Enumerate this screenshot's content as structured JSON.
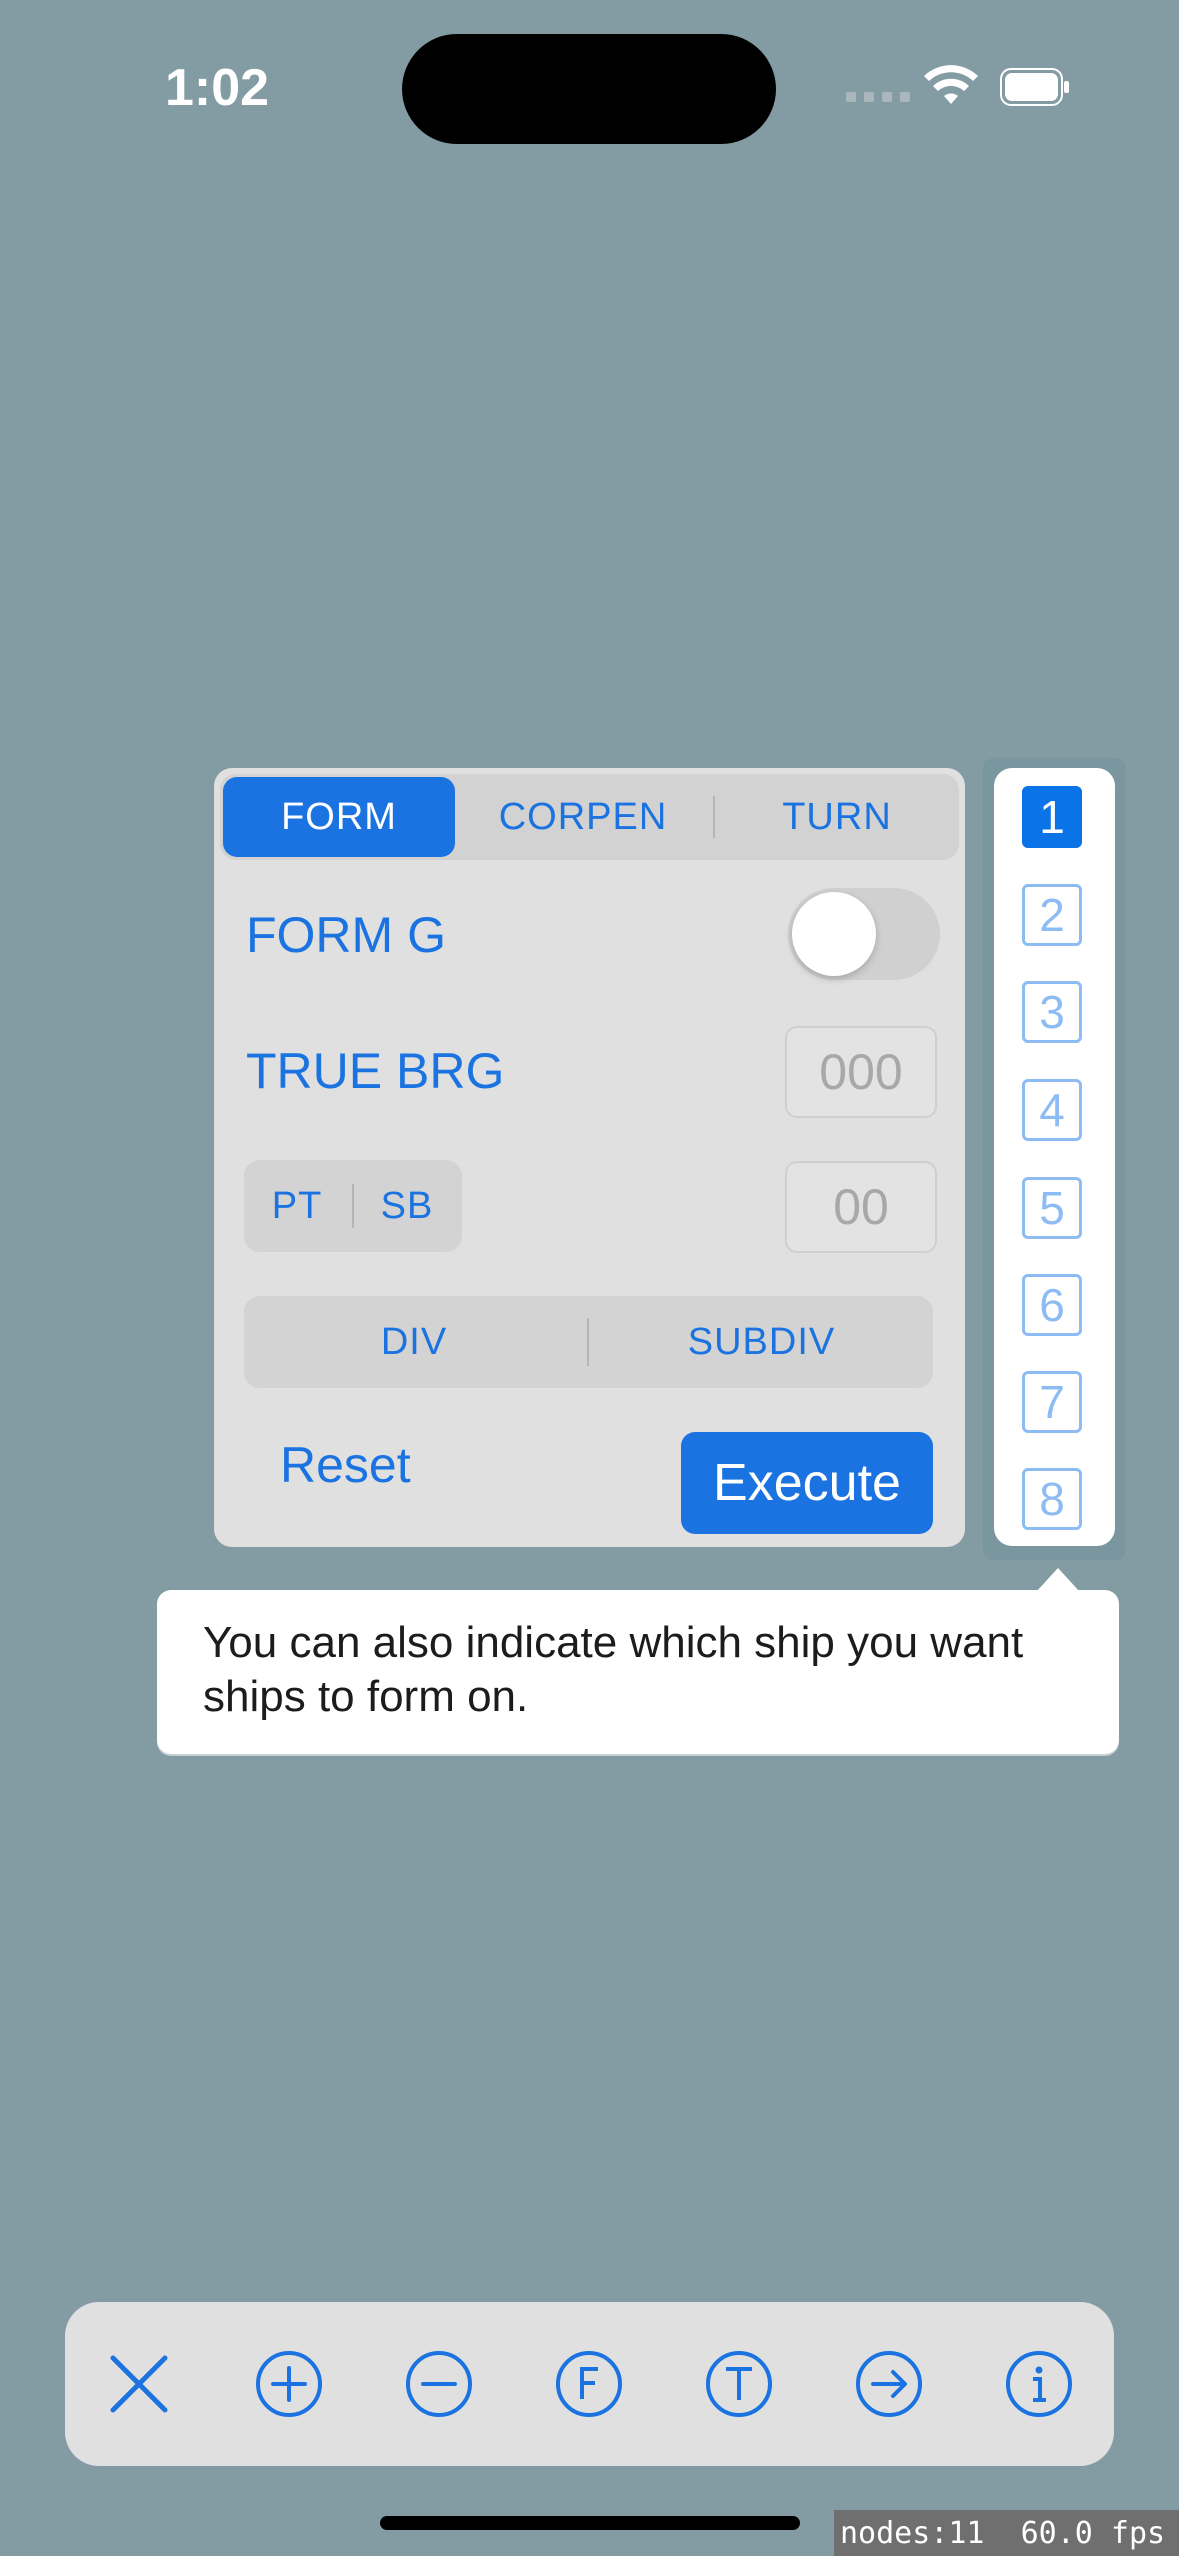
{
  "status_bar": {
    "time": "1:02",
    "icons": [
      "signal-dots-icon",
      "wifi-icon",
      "battery-icon"
    ]
  },
  "panel": {
    "tabs": [
      {
        "label": "FORM",
        "selected": true
      },
      {
        "label": "CORPEN",
        "selected": false
      },
      {
        "label": "TURN",
        "selected": false
      }
    ],
    "form_g": {
      "label": "FORM G",
      "toggle_on": false
    },
    "true_brg": {
      "label": "TRUE BRG",
      "placeholder": "000"
    },
    "side": {
      "options": [
        "PT",
        "SB"
      ],
      "placeholder": "00"
    },
    "division": {
      "options": [
        "DIV",
        "SUBDIV"
      ]
    },
    "reset_label": "Reset",
    "execute_label": "Execute"
  },
  "ship_picker": {
    "ships": [
      "1",
      "2",
      "3",
      "4",
      "5",
      "6",
      "7",
      "8"
    ],
    "selected": "1"
  },
  "tooltip": {
    "text": "You can also indicate which ship you want ships to form on."
  },
  "toolbar": {
    "buttons": [
      "close-icon",
      "plus-circle-icon",
      "minus-circle-icon",
      "f-circle-icon",
      "t-circle-icon",
      "arrow-right-circle-icon",
      "info-circle-icon"
    ]
  },
  "debug": {
    "stats": "nodes:11  60.0 fps"
  },
  "colors": {
    "accent": "#1a73e0",
    "background": "#839ca4",
    "panel": "#e0e0e0"
  }
}
